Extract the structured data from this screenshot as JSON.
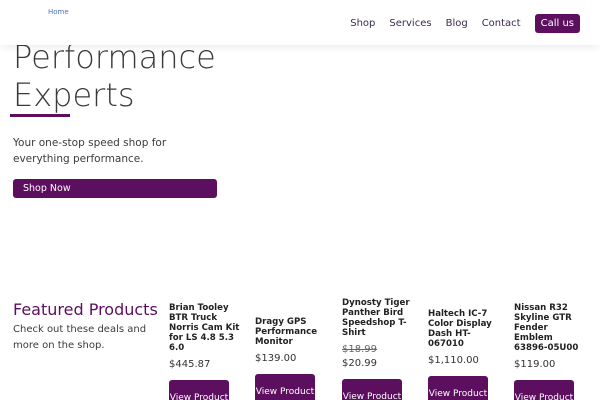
{
  "header": {
    "home_label": "Home",
    "nav": [
      "Shop",
      "Services",
      "Blog",
      "Contact"
    ],
    "cta_label": "Call us"
  },
  "hero": {
    "title_line1": "Performance",
    "title_line2": "Experts",
    "subtitle": "Your one-stop speed shop for everything performance.",
    "cta_label": "Shop Now"
  },
  "featured": {
    "title": "Featured Products",
    "subtitle": "Check out these deals and more on the shop.",
    "products": [
      {
        "name": "Brian Tooley BTR Truck Norris Cam Kit for LS 4.8 5.3 6.0",
        "price": "$445.87",
        "button": "View Product"
      },
      {
        "name": "Dragy GPS Performance Monitor",
        "price": "$139.00",
        "button": "View Product"
      },
      {
        "name": "Dynosty Tiger Panther Bird Speedshop T-Shirt",
        "old_price": "$18.99",
        "price": "$20.99",
        "button": "View Product"
      },
      {
        "name": "Haltech IC-7 Color Display Dash HT-067010",
        "price": "$1,110.00",
        "button": "View Product"
      },
      {
        "name": "Nissan R32 Skyline GTR Fender Emblem 63896-05U00",
        "price": "$119.00",
        "button": "View Product"
      }
    ]
  },
  "colors": {
    "brand": "#5c0f5f",
    "link": "#4a73c4"
  }
}
